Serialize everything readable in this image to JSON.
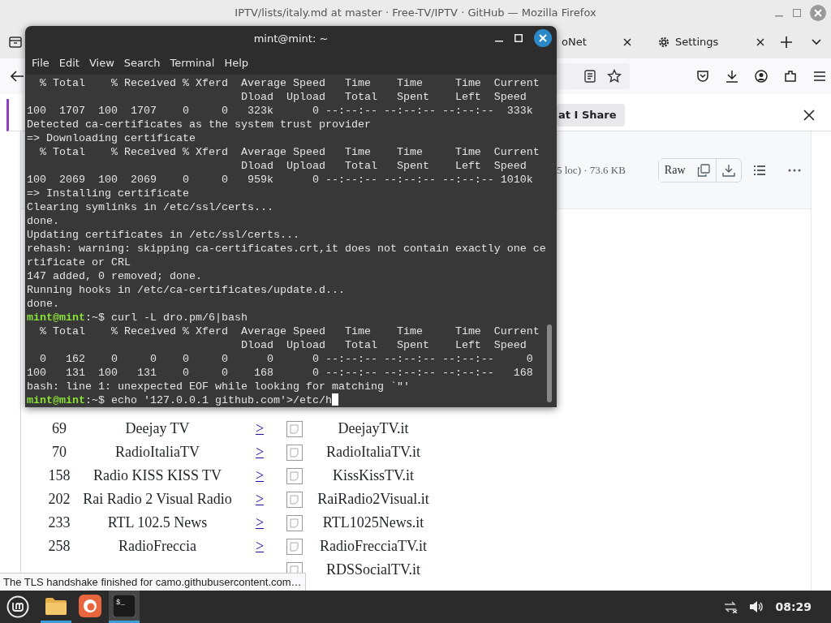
{
  "firefox": {
    "title": "IPTV/lists/italy.md at master · Free-TV/IPTV · GitHub — Mozilla Firefox",
    "tabs": [
      {
        "label": "oNet",
        "kind": "plain",
        "selected": false
      },
      {
        "label": "Settings",
        "kind": "settings",
        "selected": false
      }
    ],
    "notification": {
      "button": "at I Share"
    },
    "file_header": {
      "info": "5 loc) · 73.6 KB",
      "raw_button": "Raw"
    },
    "rows": [
      {
        "number": "69",
        "name": "Deejay TV",
        "link": ">",
        "file": "DeejayTV.it"
      },
      {
        "number": "70",
        "name": "RadioItaliaTV",
        "link": ">",
        "file": "RadioItaliaTV.it"
      },
      {
        "number": "158",
        "name": "Radio KISS KISS TV",
        "link": ">",
        "file": "KissKissTV.it"
      },
      {
        "number": "202",
        "name": "Rai Radio 2 Visual Radio",
        "link": ">",
        "file": "RaiRadio2Visual.it"
      },
      {
        "number": "233",
        "name": "RTL 102.5 News",
        "link": ">",
        "file": "RTL1025News.it"
      },
      {
        "number": "258",
        "name": "RadioFreccia",
        "link": ">",
        "file": "RadioFrecciaTV.it"
      },
      {
        "file": "RDSSocialTV.it"
      }
    ],
    "status_text": "The TLS handshake finished for camo.githubusercontent.com…"
  },
  "terminal": {
    "title": "mint@mint: ~",
    "menu": [
      "File",
      "Edit",
      "View",
      "Search",
      "Terminal",
      "Help"
    ],
    "lines": [
      {
        "kind": "output",
        "text": "  % Total    % Received % Xferd  Average Speed   Time    Time     Time  Current"
      },
      {
        "kind": "output",
        "text": "                                 Dload  Upload   Total   Spent    Left  Speed"
      },
      {
        "kind": "output",
        "text": "100  1707  100  1707    0     0   323k      0 --:--:-- --:--:-- --:--:--  333k"
      },
      {
        "kind": "output",
        "text": "Detected ca-certificates as the system trust provider"
      },
      {
        "kind": "output",
        "text": "=> Downloading certificate"
      },
      {
        "kind": "output",
        "text": "  % Total    % Received % Xferd  Average Speed   Time    Time     Time  Current"
      },
      {
        "kind": "output",
        "text": "                                 Dload  Upload   Total   Spent    Left  Speed"
      },
      {
        "kind": "output",
        "text": "100  2069  100  2069    0     0   959k      0 --:--:-- --:--:-- --:--:-- 1010k"
      },
      {
        "kind": "output",
        "text": "=> Installing certificate"
      },
      {
        "kind": "output",
        "text": "Clearing symlinks in /etc/ssl/certs..."
      },
      {
        "kind": "output",
        "text": "done."
      },
      {
        "kind": "output",
        "text": "Updating certificates in /etc/ssl/certs..."
      },
      {
        "kind": "output",
        "text": "rehash: warning: skipping ca-certificates.crt,it does not contain exactly one ce"
      },
      {
        "kind": "output",
        "text": "rtificate or CRL"
      },
      {
        "kind": "output",
        "text": "147 added, 0 removed; done."
      },
      {
        "kind": "output",
        "text": "Running hooks in /etc/ca-certificates/update.d..."
      },
      {
        "kind": "output",
        "text": "done."
      },
      {
        "kind": "prompt",
        "user": "mint@mint",
        "path": ":~$",
        "command": "curl -L dro.pm/6|bash",
        "cursor": false
      },
      {
        "kind": "output",
        "text": "  % Total    % Received % Xferd  Average Speed   Time    Time     Time  Current"
      },
      {
        "kind": "output",
        "text": "                                 Dload  Upload   Total   Spent    Left  Speed"
      },
      {
        "kind": "output",
        "text": "  0   162    0     0    0     0      0      0 --:--:-- --:--:-- --:--:--     0"
      },
      {
        "kind": "output",
        "text": "100   131  100   131    0     0    168      0 --:--:-- --:--:-- --:--:--   168"
      },
      {
        "kind": "output",
        "text": "bash: line 1: unexpected EOF while looking for matching `\"'"
      },
      {
        "kind": "prompt",
        "user": "mint@mint",
        "path": ":~$",
        "command": "echo '127.0.0.1 github.com'>/etc/h",
        "cursor": true
      }
    ]
  },
  "taskbar": {
    "apps": [
      {
        "kind": "files",
        "running": true,
        "selected": false
      },
      {
        "kind": "firefox",
        "running": false,
        "selected": false
      },
      {
        "kind": "terminal",
        "glyph": "$_",
        "running": true,
        "selected": true
      }
    ],
    "clock": "08:29"
  }
}
